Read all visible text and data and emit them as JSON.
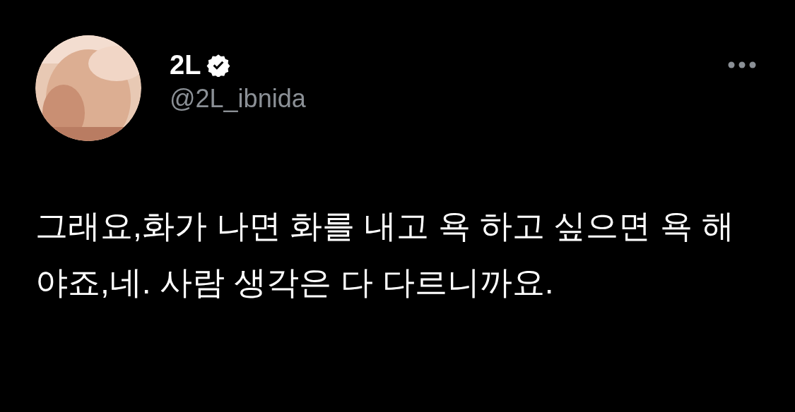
{
  "author": {
    "name": "2L",
    "verified": true,
    "handle": "@2L_ibnida"
  },
  "text": "그래요,화가 나면 화를 내고 욕 하고 싶으면 욕 해야죠,네. 사람 생각은 다 다르니까요."
}
